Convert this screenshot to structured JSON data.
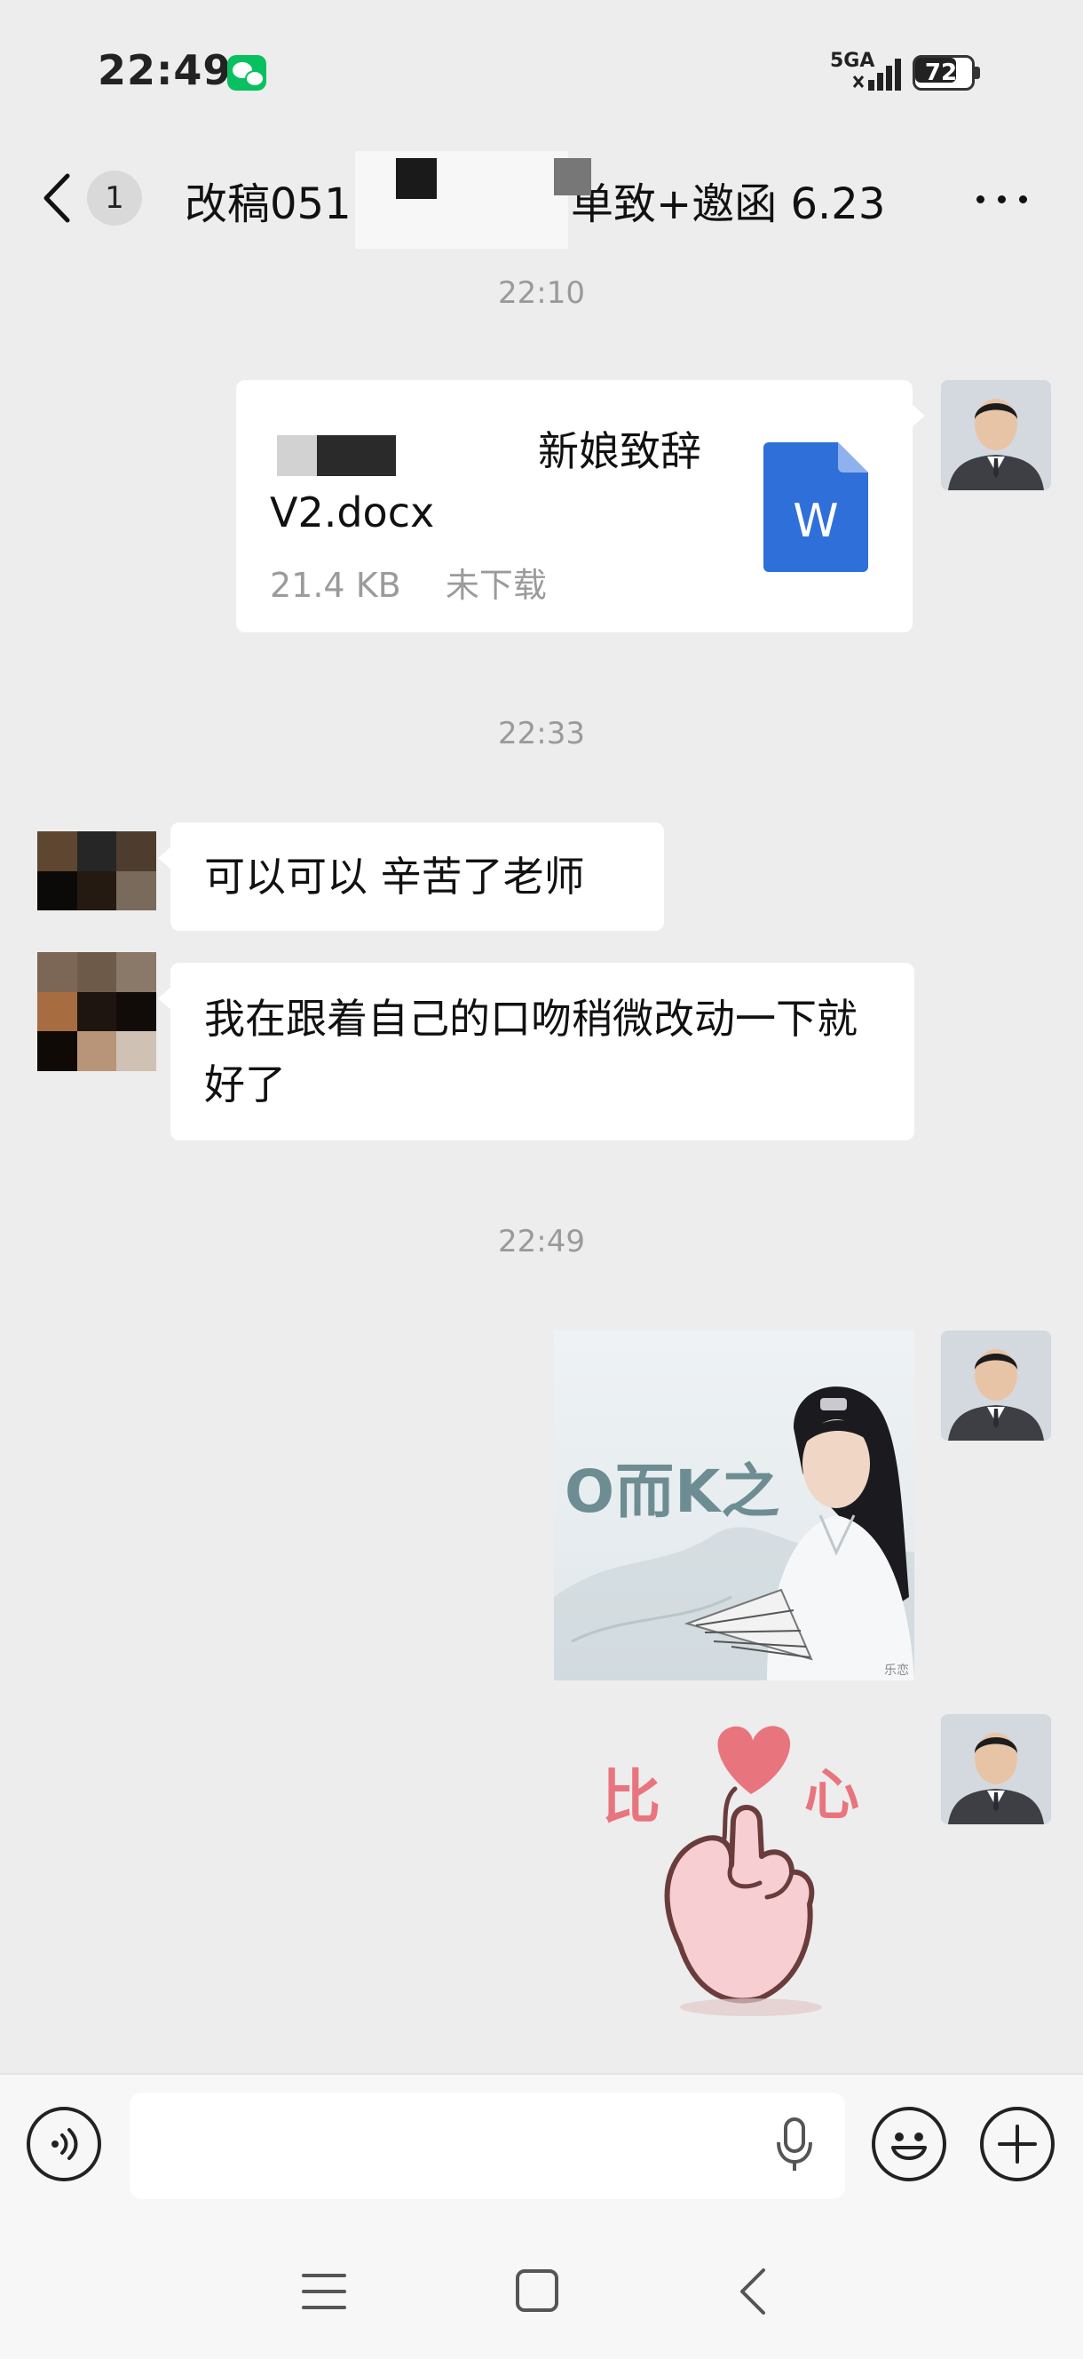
{
  "status_bar": {
    "time": "22:49",
    "network": "5GA",
    "battery": "72",
    "battery_level": 0.72,
    "app_badge_icon": "wechat-icon"
  },
  "header": {
    "unread_count": "1",
    "title_start": "改稿051",
    "title_end": "单致+邀函 6.23",
    "back_icon": "chevron-left-icon",
    "more_icon": "more-dots-icon"
  },
  "messages": {
    "ts1": "22:10",
    "file": {
      "title_line1": "新娘致辞",
      "title_line2": "V2.docx",
      "size": "21.4 KB",
      "status": "未下载",
      "icon_letter": "W",
      "icon": "word-doc-icon"
    },
    "ts2": "22:33",
    "reply1": "可以可以 辛苦了老师",
    "reply2": "我在跟着自己的口吻稍微改动一下就好了",
    "ts3": "22:49",
    "sticker1_text": "O而K之",
    "sticker1_watermark": "乐恋",
    "sticker2_left": "比",
    "sticker2_right": "心"
  },
  "input_bar": {
    "voice_icon": "voice-icon",
    "mic_icon": "microphone-icon",
    "emoji_icon": "emoji-icon",
    "plus_icon": "plus-icon",
    "placeholder": ""
  },
  "colors": {
    "background": "#ededed",
    "bubble": "#ffffff",
    "doc_blue": "#2f6fd9",
    "sticker_pink": "#e8757e"
  }
}
